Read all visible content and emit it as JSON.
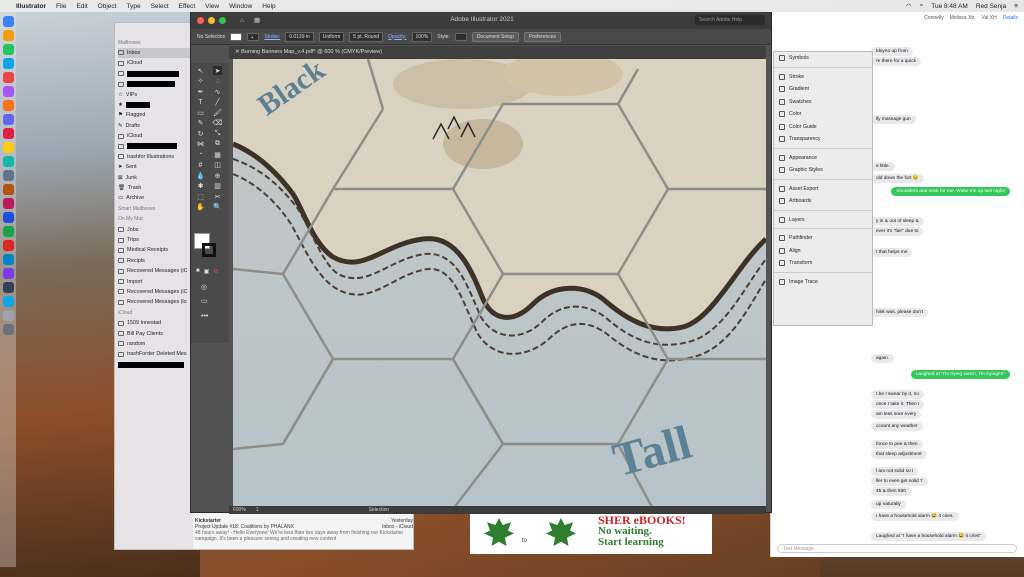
{
  "menubar": {
    "app": "Illustrator",
    "items": [
      "File",
      "Edit",
      "Object",
      "Type",
      "Select",
      "Effect",
      "View",
      "Window",
      "Help"
    ],
    "clock": "Tue 8:48 AM",
    "user": "Red Senja"
  },
  "illustrator": {
    "window_title": "Adobe Illustrator 2021",
    "search_placeholder": "Search Adobe Help",
    "control": {
      "selection": "No Selection",
      "stroke_label": "Stroke:",
      "stroke_value": "0.0139 in",
      "profile": "Uniform",
      "brush": "5 pt. Round",
      "opacity_label": "Opacity:",
      "opacity_value": "100%",
      "style_label": "Style:",
      "doc_setup": "Document Setup",
      "preferences": "Preferences"
    },
    "doc_tab": "Burning Banners Map_v.4.pdf* @ 600 % (CMYK/Preview)",
    "status": {
      "zoom": "600%",
      "page": "1",
      "mode": "Selection"
    },
    "panels": [
      "Symbols",
      "Stroke",
      "Gradient",
      "Swatches",
      "Color",
      "Color Guide",
      "Transparency",
      "Appearance",
      "Graphic Styles",
      "Asset Export",
      "Artboards",
      "Layers",
      "Pathfinder",
      "Align",
      "Transform",
      "Image Trace"
    ],
    "canvas_text": {
      "top_left": "Black",
      "bottom_right": "Tall"
    }
  },
  "mail": {
    "sections": {
      "mailboxes": "Mailboxes",
      "smart": "Smart Mailboxes",
      "on_my_mac": "On My Mac",
      "icloud": "iCloud"
    },
    "mailboxes": [
      "Inbox",
      "iCloud",
      "VIPs",
      "Flagged",
      "Drafts",
      "iCloud",
      "trashfor Illustrations",
      "Sent",
      "Junk",
      "Trash",
      "Archive"
    ],
    "on_my_mac": [
      "Jobs",
      "Trips",
      "Medical Receipts",
      "Recipts",
      "Recovered Messages (iC",
      "Import",
      "Recovered Messages (iC",
      "Recovered Messages (lo"
    ],
    "icloud_items": [
      "1509 Innestad",
      "Bill Pay Clients",
      "random",
      "trashForder Deleted Mes"
    ],
    "message": {
      "from": "Kickstarter",
      "date": "Yesterday",
      "subject": "Project Update #18: Coalitions by PHALANX",
      "folder": "Inbox - iCloud",
      "preview": "48 hours away! - Hello Everyone! We're less than two days away from finishing our Kickstarter campaign. It's been a pleasure seeing and creating new content"
    }
  },
  "ad": {
    "to": "to",
    "line1": "SHER eBOOKS!",
    "line2": "No waiting.",
    "line3": "Start learning"
  },
  "messages": {
    "header_names": [
      "Connelly",
      "Melissa Xtr,",
      "Val XH"
    ],
    "details": "Details",
    "bubbles": [
      {
        "text": "ldoyno up from",
        "me": false
      },
      {
        "text": "re there for a quick",
        "me": false
      },
      {
        "text": "lly massage gun",
        "me": false
      },
      {
        "text": "e little.",
        "me": false
      },
      {
        "text": "old down the fort 😉",
        "me": false
      },
      {
        "text": "Shoulders and neck for me.  Woke me up last night!",
        "me": true
      },
      {
        "text": "y in & out of sleep &",
        "me": false
      },
      {
        "text": "ever it's \"fair\" due to",
        "me": false
      },
      {
        "text": "t that helps me",
        "me": false
      },
      {
        "text": "hink was, please don't",
        "me": false
      },
      {
        "text": "again.",
        "me": false
      },
      {
        "text": "Laughed at \"I'm trying watch, I'm trying!!!!\"",
        "me": true
      },
      {
        "text": "t be I swear by it, no",
        "me": false
      },
      {
        "text": "once I take it. Then I",
        "me": false
      },
      {
        "text": "am less sore every",
        "me": false
      },
      {
        "text": "ccount any weather",
        "me": false
      },
      {
        "text": "fonce to pee & then",
        "me": false
      },
      {
        "text": "that sleep adjustment",
        "me": false
      },
      {
        "text": "l am not solid so I",
        "me": false
      },
      {
        "text": "ller to even get solid 7",
        "me": false
      },
      {
        "text": "45 & then 930",
        "me": false
      },
      {
        "text": "up naturally",
        "me": false
      },
      {
        "text": "I have a household alarm 😂 it cries.",
        "me": false
      },
      {
        "text": "Laughed at \"I have a household alarm 😂 it cries\"",
        "me": false
      }
    ],
    "input_placeholder": "Text Message"
  }
}
